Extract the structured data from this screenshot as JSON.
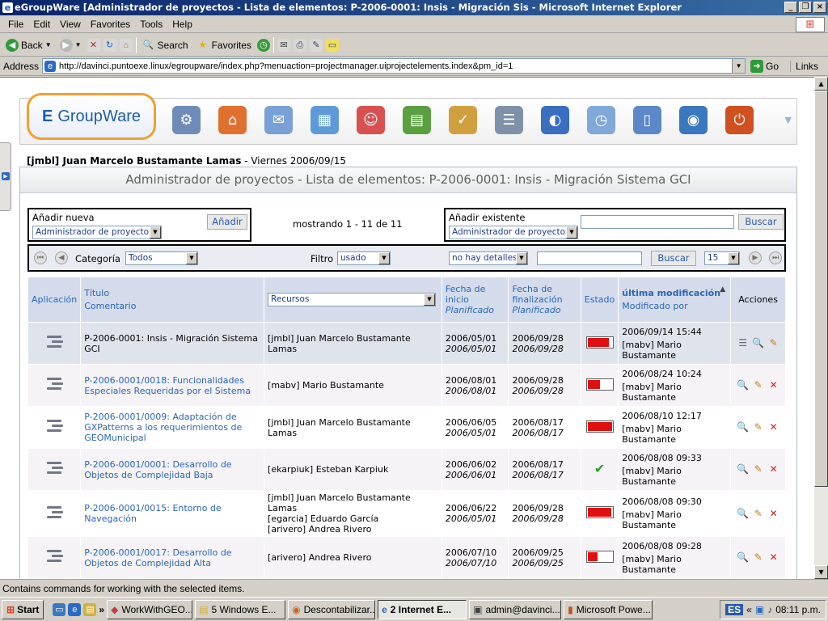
{
  "window": {
    "title": "eGroupWare [Administrador de proyectos - Lista de elementos: P-2006-0001: Insis - Migración Sis - Microsoft Internet Explorer"
  },
  "menu": [
    "File",
    "Edit",
    "View",
    "Favorites",
    "Tools",
    "Help"
  ],
  "toolbar": {
    "back": "Back",
    "search": "Search",
    "favorites": "Favorites"
  },
  "address": {
    "label": "Address",
    "url": "http://davinci.puntoexe.linux/egroupware/index.php?menuaction=projectmanager.uiprojectelements.index&pm_id=1",
    "go": "Go",
    "links": "Links"
  },
  "app": {
    "logo": "GroupWare",
    "logo_prefix": "E",
    "user": "[jmbl] Juan Marcelo Bustamante Lamas",
    "date_sep": " - ",
    "date": "Viernes 2006/09/15",
    "page_title": "Administrador de proyectos - Lista de elementos: P-2006-0001: Insis - Migración Sistema GCI",
    "icons": [
      "admin-icon",
      "home-icon",
      "email-icon",
      "calendar-icon",
      "addressbook-icon",
      "files-icon",
      "infolog-icon",
      "projectmanager-icon",
      "wiki-icon",
      "timesheet-icon",
      "manual-icon",
      "news-icon",
      "logout-icon"
    ]
  },
  "add_new": {
    "label": "Añadir nueva",
    "select": "Administrador de proyectos",
    "button": "Añadir"
  },
  "showing": "mostrando 1 - 11 de 11",
  "add_existing": {
    "label": "Añadir existente",
    "select": "Administrador de proyectos",
    "button": "Buscar"
  },
  "filters": {
    "category_label": "Categoría",
    "category": "Todos",
    "filter_label": "Filtro",
    "filter": "usado",
    "details": "no hay detalles",
    "search_button": "Buscar",
    "page_size": "15"
  },
  "columns": {
    "application": "Aplicación",
    "title": "Título",
    "comment": "Comentario",
    "resources": "Recursos",
    "start": "Fecha de inicio",
    "start_planned": "Planificado",
    "end": "Fecha de finalización",
    "end_planned": "Planificado",
    "status": "Estado",
    "modified": "última modificación",
    "modified_by": "Modificado por",
    "actions": "Acciones"
  },
  "rows": [
    {
      "title": "P-2006-0001: Insis - Migración Sistema GCI",
      "link": false,
      "resources": "[jmbl] Juan Marcelo Bustamante Lamas",
      "start": "2006/05/01",
      "start_planned": "2006/05/01",
      "end": "2006/09/28",
      "end_planned": "2006/09/28",
      "status": "bar",
      "progress": 0.85,
      "modified": "2006/09/14 15:44",
      "modified_by": "[mabv] Mario Bustamante",
      "actions": [
        "projectmanager-icon",
        "view-icon",
        "edit-icon"
      ]
    },
    {
      "title": "P-2006-0001/0018: Funcionalidades Especiales Requeridas por el Sistema",
      "link": true,
      "resources": "[mabv] Mario Bustamante",
      "start": "2006/08/01",
      "start_planned": "2006/08/01",
      "end": "2006/09/28",
      "end_planned": "2006/09/28",
      "status": "bar",
      "progress": 0.5,
      "modified": "2006/08/24 10:24",
      "modified_by": "[mabv] Mario Bustamante",
      "actions": [
        "view-icon",
        "edit-icon",
        "delete-icon"
      ]
    },
    {
      "title": "P-2006-0001/0009: Adaptación de GXPatterns a los requerimientos de GEOMunicipal",
      "link": true,
      "resources": "[jmbl] Juan Marcelo Bustamante Lamas",
      "start": "2006/06/05",
      "start_planned": "2006/05/01",
      "end": "2006/08/17",
      "end_planned": "2006/08/17",
      "status": "bar",
      "progress": 1.0,
      "modified": "2006/08/10 12:17",
      "modified_by": "[mabv] Mario Bustamante",
      "actions": [
        "view-icon",
        "edit-icon",
        "delete-icon"
      ]
    },
    {
      "title": "P-2006-0001/0001: Desarrollo de Objetos de Complejidad Baja",
      "link": true,
      "resources": "[ekarpiuk] Esteban Karpiuk",
      "start": "2006/06/02",
      "start_planned": "2006/06/01",
      "end": "2006/08/17",
      "end_planned": "2006/08/17",
      "status": "done",
      "progress": 1.0,
      "modified": "2006/08/08 09:33",
      "modified_by": "[mabv] Mario Bustamante",
      "actions": [
        "view-icon",
        "edit-icon",
        "delete-icon"
      ]
    },
    {
      "title": "P-2006-0001/0015: Entorno de Navegación",
      "link": true,
      "resources": "[jmbl] Juan Marcelo Bustamante Lamas\n[egarcia] Eduardo García\n[arivero] Andrea Rivero",
      "start": "2006/06/22",
      "start_planned": "2006/05/01",
      "end": "2006/09/28",
      "end_planned": "2006/09/28",
      "status": "bar",
      "progress": 0.95,
      "modified": "2006/08/08 09:30",
      "modified_by": "[mabv] Mario Bustamante",
      "actions": [
        "view-icon",
        "edit-icon",
        "delete-icon"
      ]
    },
    {
      "title": "P-2006-0001/0017: Desarrollo de Objetos de Complejidad Alta",
      "link": true,
      "resources": "[arivero] Andrea Rivero",
      "start": "2006/07/10",
      "start_planned": "2006/07/10",
      "end": "2006/09/25",
      "end_planned": "2006/09/25",
      "status": "bar",
      "progress": 0.4,
      "modified": "2006/08/08 09:28",
      "modified_by": "[mabv] Mario Bustamante",
      "actions": [
        "view-icon",
        "edit-icon",
        "delete-icon"
      ]
    }
  ],
  "statusbar": "Contains commands for working with the selected items.",
  "taskbar": {
    "start": "Start",
    "tasks": [
      "WorkWithGEO...",
      "5 Windows E...",
      "Descontabilizar...",
      "2 Internet E...",
      "admin@davinci...",
      "Microsoft Powe..."
    ],
    "active_index": 3,
    "lang": "ES",
    "clock": "08:11 p.m."
  },
  "colors": {
    "accent": "#2a66b8",
    "header_bg": "#d4dceb",
    "status_red": "#e01010",
    "titlebar": "#0a246a"
  }
}
